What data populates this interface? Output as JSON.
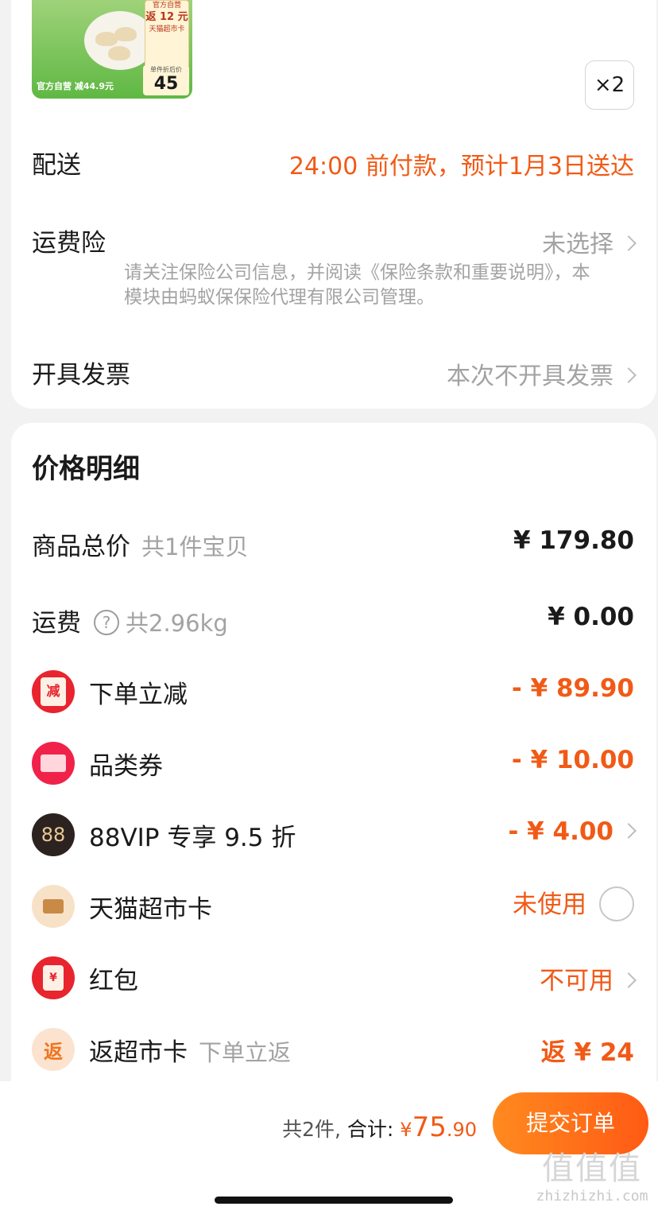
{
  "product": {
    "thumb_tag_lines": [
      "官方自营",
      "返 12 元",
      "天猫超市卡"
    ],
    "thumb_price_label": "单件折后价",
    "thumb_price_value": "45",
    "thumb_strip": "官方自营 减44.9元",
    "quantity": "×2"
  },
  "order_options": {
    "delivery_label": "配送",
    "delivery_value": "24:00 前付款，预计1月3日送达",
    "shipping_insurance_label": "运费险",
    "shipping_insurance_value": "未选择",
    "insurance_note": "请关注保险公司信息，并阅读《保险条款和重要说明》，本模块由蚂蚁保保险代理有限公司管理。",
    "invoice_label": "开具发票",
    "invoice_value": "本次不开具发票"
  },
  "price_detail": {
    "title": "价格明细",
    "rows": [
      {
        "label": "商品总价",
        "sub": "共1件宝贝",
        "value": "¥ 179.80"
      },
      {
        "label": "运费",
        "sub": "共2.96kg",
        "value": "¥ 0.00",
        "help": "?"
      },
      {
        "label": "下单立减",
        "value": "- ¥ 89.90",
        "icon_text": "减"
      },
      {
        "label": "品类券",
        "value": "- ¥ 10.00"
      },
      {
        "label": "88VIP 专享 9.5 折",
        "value": "- ¥ 4.00",
        "icon_text": "88"
      },
      {
        "label": "天猫超市卡",
        "value": "未使用"
      },
      {
        "label": "红包",
        "value": "不可用",
        "icon_text": "¥"
      },
      {
        "label": "返超市卡",
        "sub": "下单立返",
        "value": "返 ¥ 24",
        "icon_text": "返"
      }
    ]
  },
  "bottom_bar": {
    "count_text": "共2件,",
    "total_label": "合计:",
    "currency": "¥",
    "total_int": "75",
    "total_dec": ".90",
    "submit_label": "提交订单"
  },
  "watermark": {
    "big": "值值值",
    "small": "zhizhizhi.com"
  },
  "colors": {
    "accent": "#f15a16",
    "muted": "#a3a3a3",
    "button_start": "#ff8a1f",
    "button_end": "#ff5a14"
  }
}
